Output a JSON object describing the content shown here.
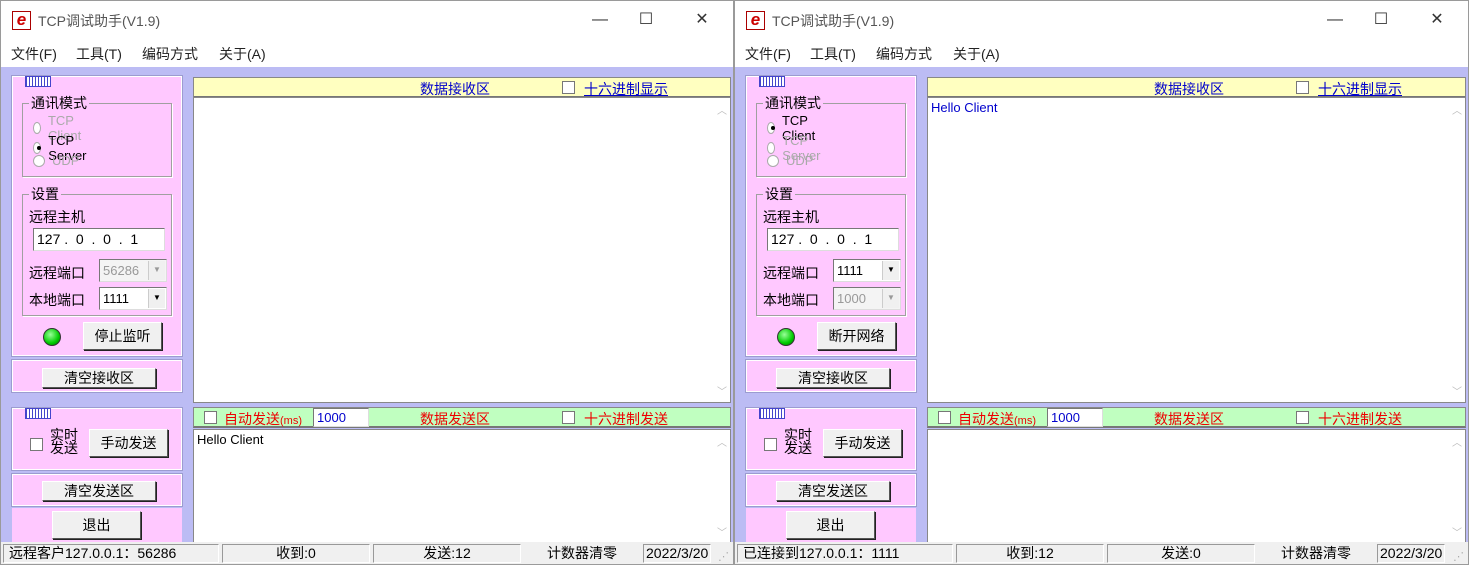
{
  "windows": [
    {
      "title": "TCP调试助手(V1.9)",
      "controls": {
        "minimize": "—",
        "maximize": "☐",
        "close": "✕"
      },
      "menu": [
        "文件(F)",
        "工具(T)",
        "编码方式",
        "关于(A)"
      ],
      "comm_mode": {
        "label": "通讯模式",
        "options": [
          "TCP Client",
          "TCP Server",
          "UDP"
        ],
        "selected": 1,
        "disabled": [
          0,
          2
        ]
      },
      "settings": {
        "label": "设置",
        "remote_host_label": "远程主机",
        "remote_host": "127 .  0  .  0  .  1",
        "remote_port_label": "远程端口",
        "remote_port": "56286",
        "remote_port_disabled": true,
        "local_port_label": "本地端口",
        "local_port": "1111",
        "local_port_disabled": false
      },
      "status_led": "#00cc00",
      "action_button": "停止监听",
      "clear_recv": "清空接收区",
      "realtime_send": "实时\n发送",
      "manual_send": "手动发送",
      "clear_send": "清空发送区",
      "exit": "退出",
      "recv_title": "数据接收区",
      "hex_display": "十六进制显示",
      "recv_content": "",
      "auto_send": "自动发送",
      "auto_send_unit": "(ms)",
      "interval": "1000",
      "send_title": "数据发送区",
      "hex_send": "十六进制发送",
      "send_content": "Hello Client",
      "status": {
        "conn": "远程客户127.0.0.1：56286",
        "received": "收到:0",
        "sent": "发送:12",
        "reset": "计数器清零",
        "date": "2022/3/20"
      }
    },
    {
      "title": "TCP调试助手(V1.9)",
      "controls": {
        "minimize": "—",
        "maximize": "☐",
        "close": "✕"
      },
      "menu": [
        "文件(F)",
        "工具(T)",
        "编码方式",
        "关于(A)"
      ],
      "comm_mode": {
        "label": "通讯模式",
        "options": [
          "TCP Client",
          "TCP Server",
          "UDP"
        ],
        "selected": 0,
        "disabled": [
          1,
          2
        ]
      },
      "settings": {
        "label": "设置",
        "remote_host_label": "远程主机",
        "remote_host": "127 .  0  .  0  .  1",
        "remote_port_label": "远程端口",
        "remote_port": "1111",
        "remote_port_disabled": false,
        "local_port_label": "本地端口",
        "local_port": "1000",
        "local_port_disabled": true
      },
      "status_led": "#00cc00",
      "action_button": "断开网络",
      "clear_recv": "清空接收区",
      "realtime_send": "实时\n发送",
      "manual_send": "手动发送",
      "clear_send": "清空发送区",
      "exit": "退出",
      "recv_title": "数据接收区",
      "hex_display": "十六进制显示",
      "recv_content": "Hello Client",
      "auto_send": "自动发送",
      "auto_send_unit": "(ms)",
      "interval": "1000",
      "send_title": "数据发送区",
      "hex_send": "十六进制发送",
      "send_content": "",
      "status": {
        "conn": "已连接到127.0.0.1：1111",
        "received": "收到:12",
        "sent": "发送:0",
        "reset": "计数器清零",
        "date": "2022/3/20"
      }
    }
  ]
}
